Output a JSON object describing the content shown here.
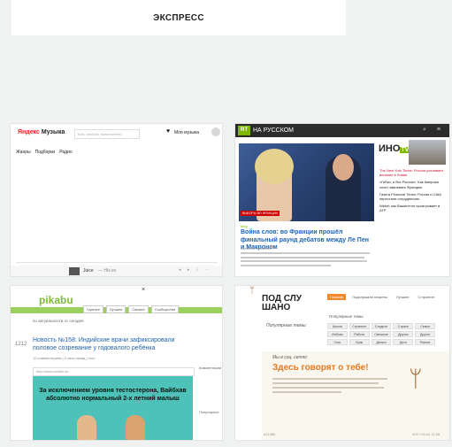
{
  "header": {
    "title": "ЭКСПРЕСС"
  },
  "yandex_music": {
    "logo_main": "Яндекс",
    "logo_sub": "Музыка",
    "search_placeholder": "Трек, альбом, исполнитель",
    "my_music": "Моя музыка",
    "nav": [
      "Жанры",
      "Подборки",
      "Радио"
    ],
    "player_track": "Juice",
    "player_artist": "— His ex"
  },
  "rt": {
    "logo": "RT",
    "title": "НА РУССКОМ",
    "photo_caption": "ВЫБОРЫ ВО ФРАНЦИИ",
    "category": "Мир",
    "headline": "Война слов: во Франции прошёл финальный раунд дебатов между Ле Пен и Макроном",
    "meta": "Валерия Минаева",
    "side_logo": "ИНО",
    "side_logo_tv": "TV",
    "side_items": [
      "The New York Times: Россия усиливает влияние в Ливии",
      "«Гибко, и без России». Как Америка хочет завоевать Францию",
      "Газета Financial Times: Россия и США перестали сотрудничать",
      "Nikkei: как Вашингтон проигрывает в АТР"
    ]
  },
  "pikabu": {
    "close": "×",
    "logo": "pikabu",
    "tabs": [
      "Горячее",
      "Лучшее",
      "Свежее",
      "Сообщества"
    ],
    "filter": "по актуальности  от сегодня",
    "rating": "1212",
    "title": "Новость №158: Индийские врачи зафиксировали половое созревание у годовалого ребёнка",
    "meta": "10 комментариев  |  4 часа назад  |  пост",
    "url": "http://www.indiatv.in/...",
    "image_text": "За исключением уровня тестостерона, Вайбхав абсолютно нормальный 2-х летний малыш",
    "sidebar_1": "Комментарии",
    "sidebar_2": "Популярное"
  },
  "podslushano": {
    "logo": "ПОД СЛУ ШАНО",
    "subtitle": "Популярные темы:",
    "nav": [
      "Главная",
      "Подслушали секреты",
      "Лучшее",
      "О проекте"
    ],
    "topics_title": "Популярные темы:",
    "topics": [
      "Школа",
      "Странное",
      "Стыдное",
      "Страхи",
      "Семья",
      "Любовь",
      "Работа",
      "Смешное",
      "Друзья",
      "Другое",
      "Секс",
      "Брак",
      "Деньги",
      "Дети",
      "Разное"
    ],
    "banner_sub": "Мы в соц. сетях:",
    "banner_title": "Здесь говорят о тебе!",
    "foot_left": "#21386",
    "foot_right": "2017-05-04 11:58"
  }
}
